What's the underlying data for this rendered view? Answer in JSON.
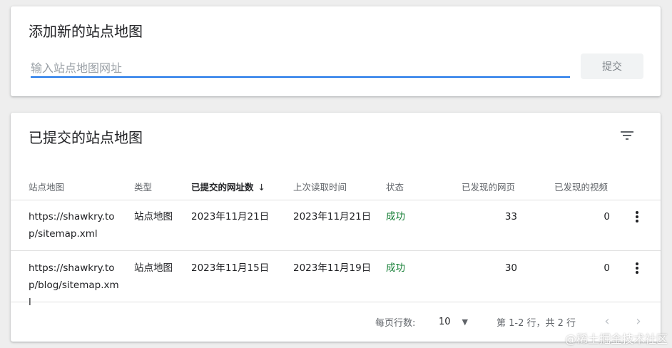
{
  "add_card": {
    "title": "添加新的站点地图",
    "input_placeholder": "输入站点地图网址",
    "input_value": "",
    "submit_label": "提交"
  },
  "list_card": {
    "title": "已提交的站点地图",
    "filter_icon": "filter-icon",
    "columns": [
      "站点地图",
      "类型",
      "已提交的网址数",
      "上次读取时间",
      "状态",
      "已发现的网页",
      "已发现的视频"
    ],
    "sorted_column": "已提交的网址数",
    "sort_direction": "desc",
    "rows": [
      {
        "sitemap": "https://shawkry.top/sitemap.xml",
        "type": "站点地图",
        "submitted": "2023年11月21日",
        "last_read": "2023年11月21日",
        "status": "成功",
        "pages": "33",
        "videos": "0"
      },
      {
        "sitemap": "https://shawkry.top/blog/sitemap.xml",
        "type": "站点地图",
        "submitted": "2023年11月15日",
        "last_read": "2023年11月19日",
        "status": "成功",
        "pages": "30",
        "videos": "0"
      }
    ],
    "footer": {
      "rows_per_page_label": "每页行数:",
      "rows_per_page_value": "10",
      "range_text": "第 1-2 行，共 2 行"
    }
  },
  "colors": {
    "accent": "#1a73e8",
    "success": "#188038",
    "background": "#eeeeee"
  },
  "watermark": "@稀土掘金技术社区"
}
